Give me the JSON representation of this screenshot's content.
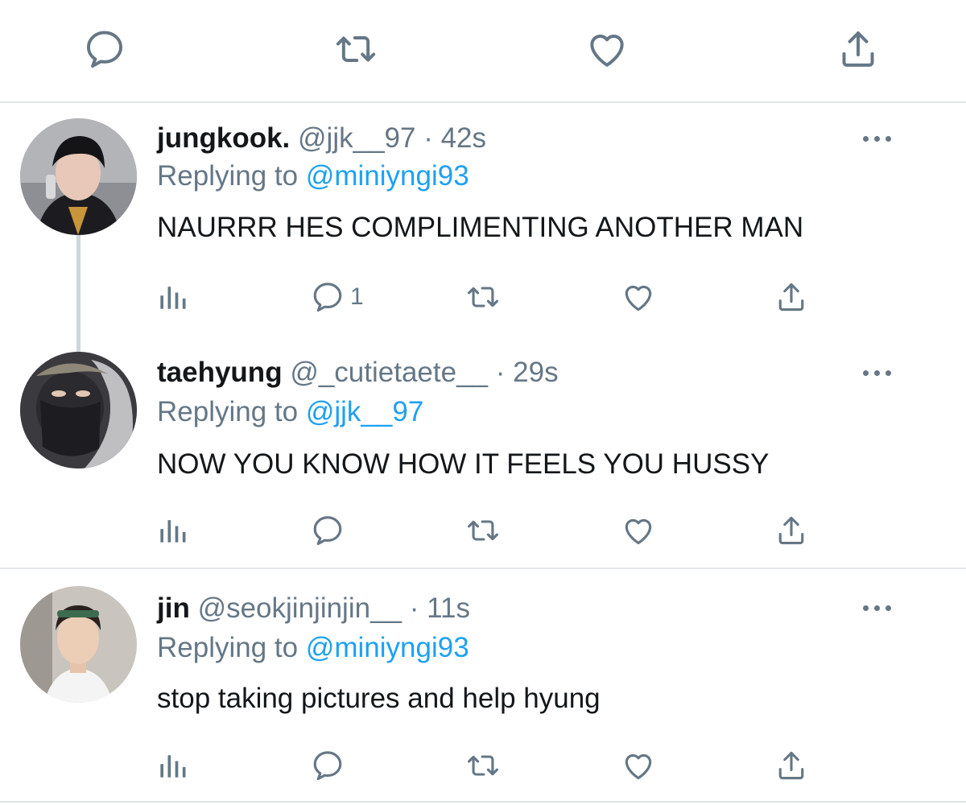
{
  "colors": {
    "text": "#14171a",
    "muted": "#657786",
    "link": "#1da1f2",
    "divider": "#e1e5e9",
    "thread_line": "#ccd6dd"
  },
  "top_actions": {
    "icons": [
      "reply-icon",
      "retweet-icon",
      "like-icon",
      "share-icon"
    ]
  },
  "tweets": [
    {
      "display_name": "jungkook.",
      "handle": "@jjk__97",
      "separator": "·",
      "time": "42s",
      "replying_prefix": "Replying to",
      "replying_to": "@miniyngi93",
      "text": "NAURRR HES COMPLIMENTING ANOTHER MAN",
      "reply_count": "1",
      "avatar": "avatar-photo"
    },
    {
      "display_name": "taehyung",
      "handle": "@_cutietaete__",
      "separator": "·",
      "time": "29s",
      "replying_prefix": "Replying to",
      "replying_to": "@jjk__97",
      "text": "NOW YOU KNOW HOW IT FEELS YOU HUSSY",
      "reply_count": "",
      "avatar": "avatar-photo"
    },
    {
      "display_name": "jin",
      "handle": "@seokjinjinjin__",
      "separator": "·",
      "time": "11s",
      "replying_prefix": "Replying to",
      "replying_to": "@miniyngi93",
      "text": "stop taking pictures and help hyung",
      "reply_count": "",
      "avatar": "avatar-photo"
    }
  ]
}
